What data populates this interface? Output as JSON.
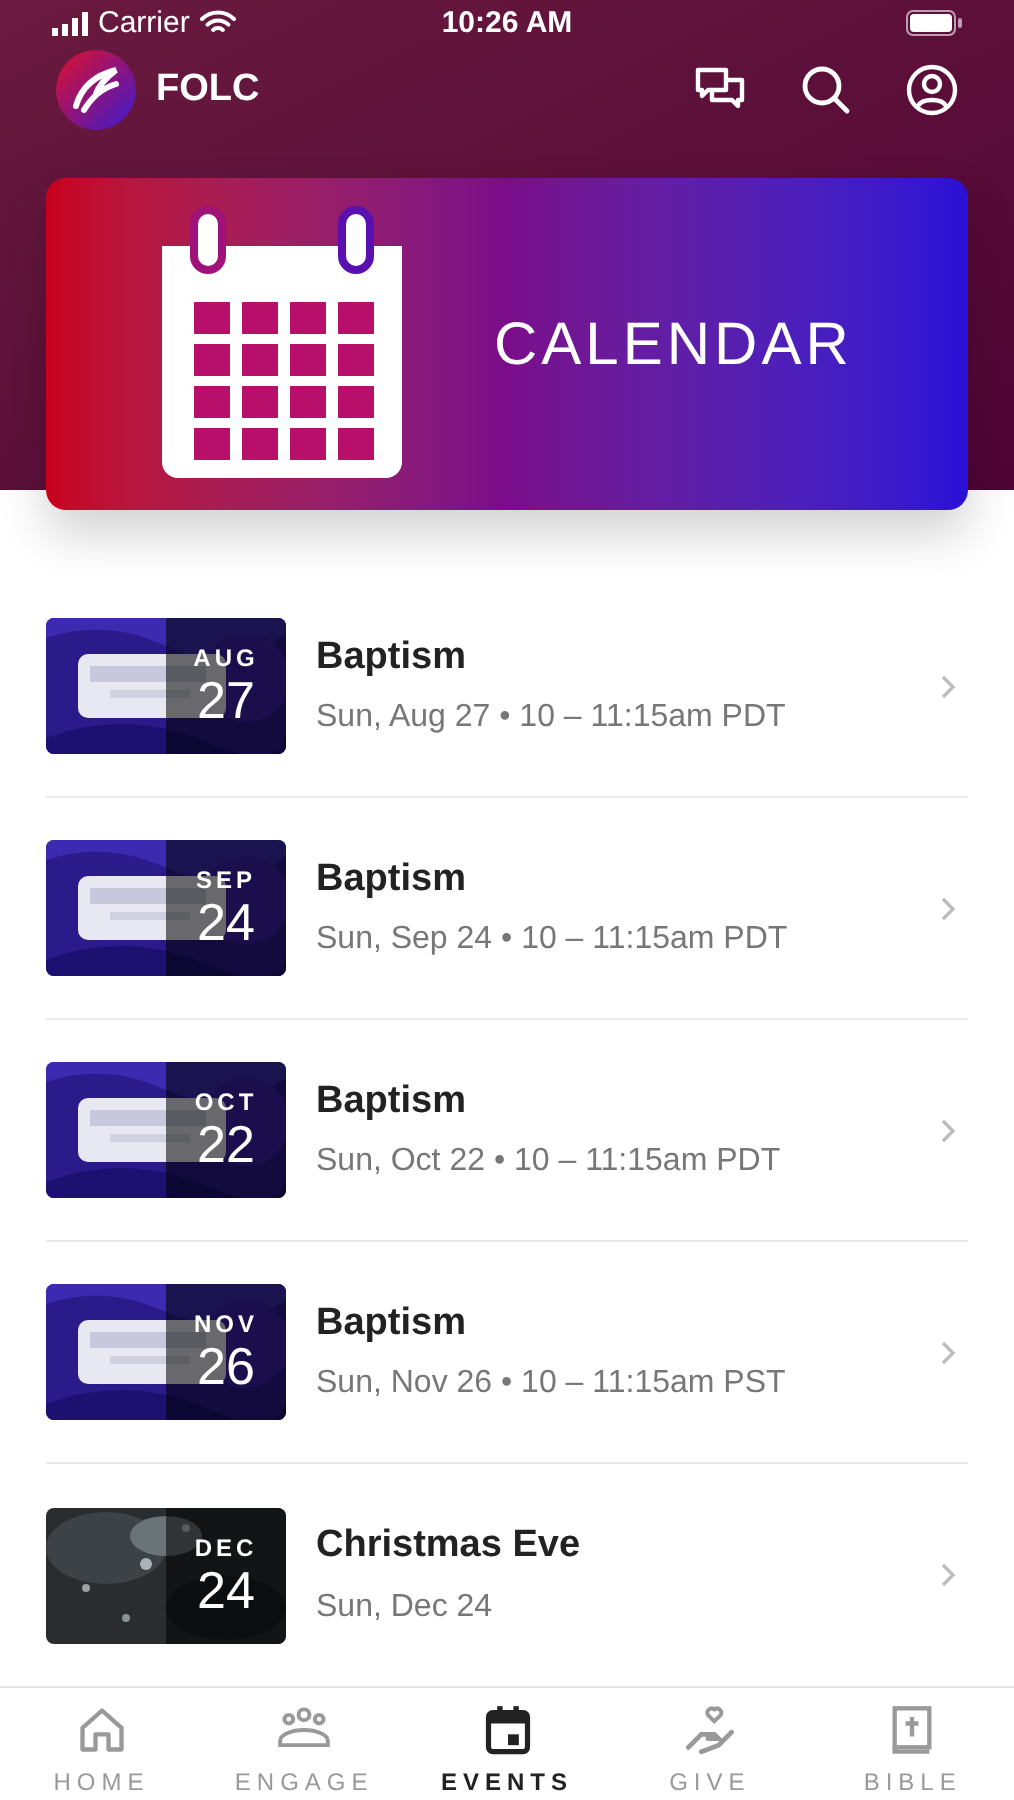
{
  "status_bar": {
    "carrier": "Carrier",
    "time": "10:26 AM"
  },
  "header": {
    "title": "FOLC"
  },
  "banner": {
    "title": "CALENDAR"
  },
  "events": [
    {
      "kind": "baptism",
      "month": "AUG",
      "day": "27",
      "title": "Baptism",
      "when": "Sun, Aug 27 • 10 – 11:15am PDT"
    },
    {
      "kind": "baptism",
      "month": "SEP",
      "day": "24",
      "title": "Baptism",
      "when": "Sun, Sep 24 • 10 – 11:15am PDT"
    },
    {
      "kind": "baptism",
      "month": "OCT",
      "day": "22",
      "title": "Baptism",
      "when": "Sun, Oct 22 • 10 – 11:15am PDT"
    },
    {
      "kind": "baptism",
      "month": "NOV",
      "day": "26",
      "title": "Baptism",
      "when": "Sun, Nov 26 • 10 – 11:15am PST"
    },
    {
      "kind": "snow",
      "month": "DEC",
      "day": "24",
      "title": "Christmas Eve",
      "when": "Sun, Dec 24"
    }
  ],
  "tabs": [
    {
      "label": "HOME",
      "kind": "home",
      "selected": false
    },
    {
      "label": "ENGAGE",
      "kind": "people",
      "selected": false
    },
    {
      "label": "EVENTS",
      "kind": "calendar",
      "selected": true
    },
    {
      "label": "GIVE",
      "kind": "give",
      "selected": false
    },
    {
      "label": "BIBLE",
      "kind": "bible",
      "selected": false
    }
  ]
}
